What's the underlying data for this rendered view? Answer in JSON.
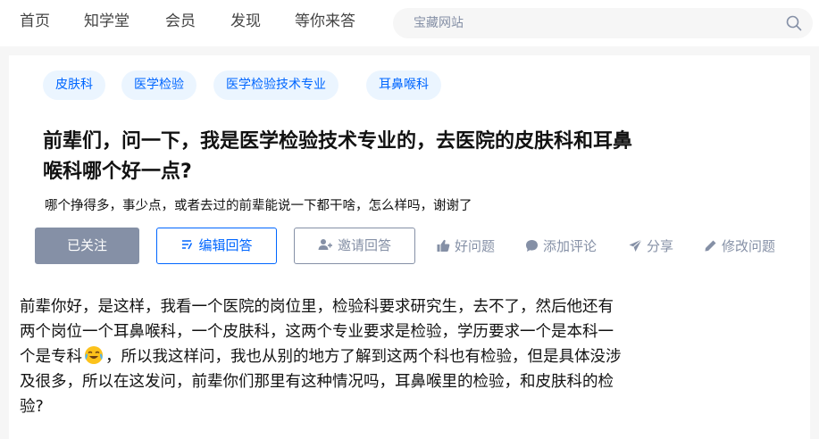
{
  "nav": {
    "links": [
      "首页",
      "知学堂",
      "会员",
      "发现",
      "等你来答"
    ],
    "search_placeholder": "宝藏网站"
  },
  "question": {
    "tags": [
      "皮肤科",
      "医学检验",
      "医学检验技术专业",
      "耳鼻喉科"
    ],
    "title_line1": "前辈们，问一下，我是医学检验技术专业的，去医院的皮肤科和耳鼻",
    "title_line2": "喉科哪个好一点?",
    "detail": "哪个挣得多，事少点，或者去过的前辈能说一下都干啥，怎么样吗，谢谢了",
    "buttons": {
      "followed": "已关注",
      "write_answer": "编辑回答",
      "invite": "邀请回答"
    },
    "actions": {
      "good_question": "好问题",
      "add_comment": "添加评论",
      "share": "分享",
      "edit_question": "修改问题"
    }
  },
  "answer": {
    "line1": "前辈你好，是这样，我看一个医院的岗位里，检验科要求研究生，去不了，然后他还有",
    "line2": "两个岗位一个耳鼻喉科，一个皮肤科，这两个专业要求是检验，学历要求一个是本科一",
    "line3_before_emoji": "个是专科",
    "line3_after_emoji": "，所以我这样问，我也从别的地方了解到这两个科也有检验，但是具体没涉",
    "line4": "及很多，所以在这发问，前辈你们那里有这种情况吗，耳鼻喉里的检验，和皮肤科的检",
    "line5": "验?"
  },
  "colors": {
    "accent": "#0066ff",
    "muted": "#8590a6",
    "tag_bg": "#ebf5ff"
  }
}
